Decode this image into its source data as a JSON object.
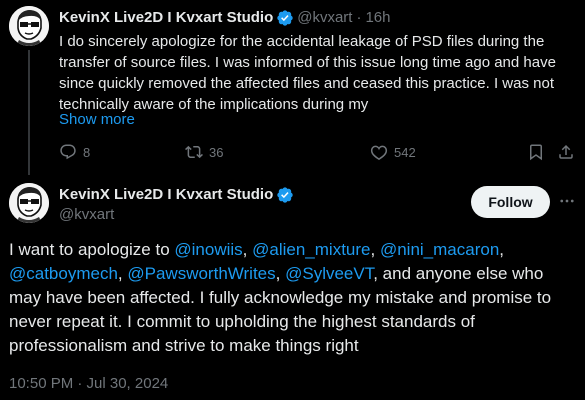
{
  "tweet1": {
    "author_name": "KevinX Live2D I Kvxart Studio",
    "handle": "@kvxart",
    "separator": "·",
    "time": "16h",
    "text_lines": [
      "I do sincerely apologize for the accidental leakage of PSD files during the",
      "transfer of source files. I was informed of this issue long time ago and have",
      "since quickly removed the affected files and ceased this practice. I was not",
      "technically aware of the implications during my"
    ],
    "show_more": "Show more",
    "replies": "8",
    "reposts": "36",
    "likes": "542",
    "icons": [
      "reply-icon",
      "retweet-icon",
      "like-icon",
      "bookmark-icon",
      "share-icon",
      "verified-badge-icon"
    ]
  },
  "tweet2": {
    "author_name": "KevinX Live2D I Kvxart Studio",
    "handle": "@kvxart",
    "follow_label": "Follow",
    "body": {
      "part1": "I want to apologize to ",
      "m1": "@inowiis",
      "sep1": ", ",
      "m2": "@alien_mixture",
      "sep2": ", ",
      "m3": "@nini_macaron",
      "sep3": ",",
      "m4": "@catboymech",
      "sep4": ", ",
      "m5": "@PawsworthWrites",
      "sep5": ", ",
      "m6": "@SylveeVT",
      "part2": ", and anyone else who may have been affected. I fully acknowledge my mistake and promise to never repeat it. I commit to upholding the highest standards of professionalism and strive to make things right"
    },
    "timestamp": "10:50 PM · Jul 30, 2024"
  },
  "colors": {
    "background": "#000000",
    "text": "#e7e9ea",
    "muted": "#71767b",
    "link": "#1d9bf0",
    "follow_bg": "#eff3f4"
  }
}
